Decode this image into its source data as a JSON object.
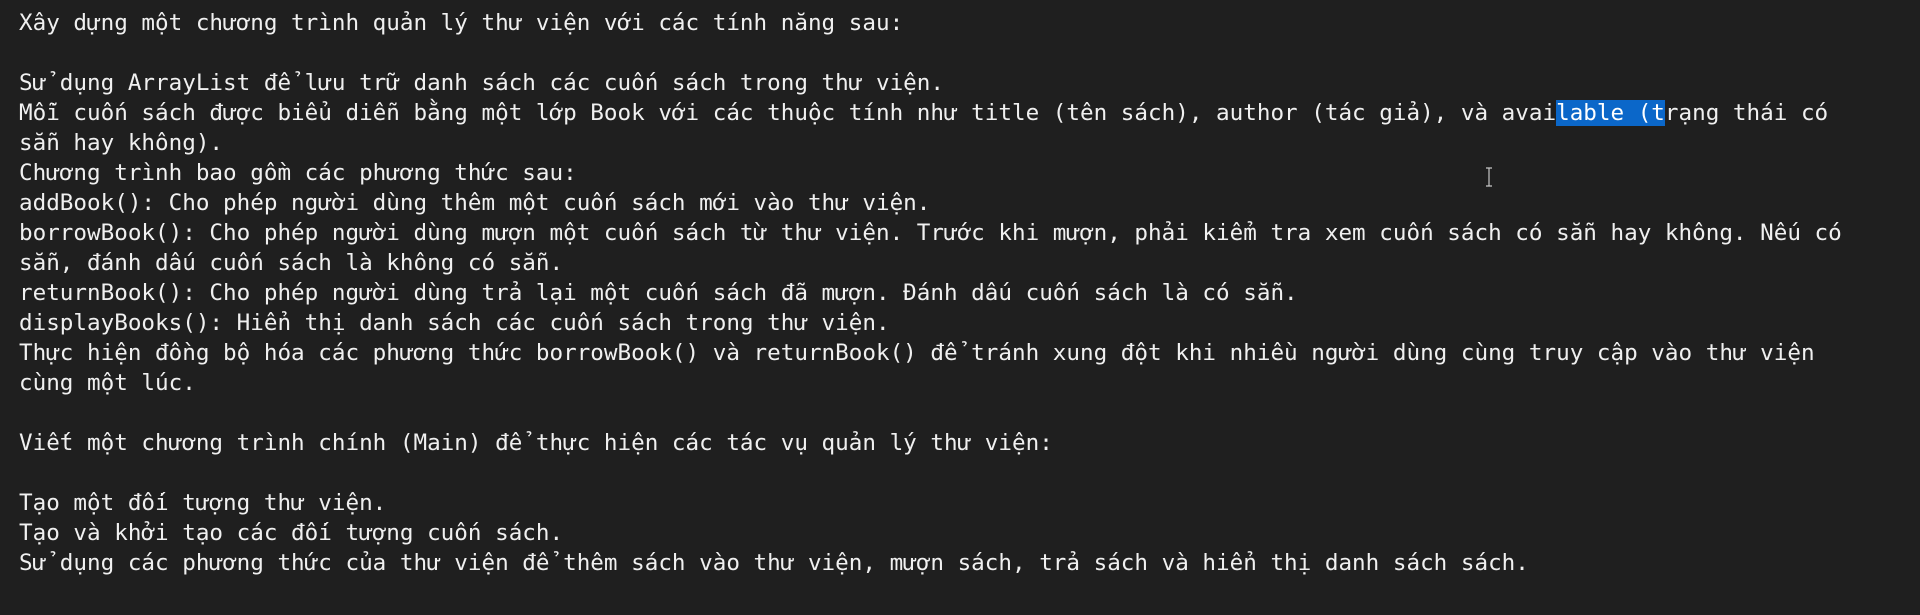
{
  "colors": {
    "background": "#1f1f1f",
    "text": "#f0f0f0",
    "selection": "#0b67c9"
  },
  "editor": {
    "lines": [
      "Xây dựng một chương trình quản lý thư viện với các tính năng sau:",
      "",
      "Sử dụng ArrayList để lưu trữ danh sách các cuốn sách trong thư viện.",
      "",
      "sẵn hay không).",
      "Chương trình bao gồm các phương thức sau:",
      "addBook(): Cho phép người dùng thêm một cuốn sách mới vào thư viện.",
      "borrowBook(): Cho phép người dùng mượn một cuốn sách từ thư viện. Trước khi mượn, phải kiểm tra xem cuốn sách có sẵn hay không. Nếu có",
      "sẵn, đánh dấu cuốn sách là không có sẵn.",
      "returnBook(): Cho phép người dùng trả lại một cuốn sách đã mượn. Đánh dấu cuốn sách là có sẵn.",
      "displayBooks(): Hiển thị danh sách các cuốn sách trong thư viện.",
      "Thực hiện đồng bộ hóa các phương thức borrowBook() và returnBook() để tránh xung đột khi nhiều người dùng cùng truy cập vào thư viện",
      "cùng một lúc.",
      "",
      "Viết một chương trình chính (Main) để thực hiện các tác vụ quản lý thư viện:",
      "",
      "Tạo một đối tượng thư viện.",
      "Tạo và khởi tạo các đối tượng cuốn sách.",
      "Sử dụng các phương thức của thư viện để thêm sách vào thư viện, mượn sách, trả sách và hiển thị danh sách sách."
    ],
    "selected_line": {
      "before": "Mỗi cuốn sách được biểu diễn bằng một lớp Book với các thuộc tính như title (tên sách), author (tác giả), và avai",
      "selected": "lable (t",
      "after": "rạng thái có"
    }
  },
  "cursor": {
    "icon": "text-cursor-icon"
  }
}
